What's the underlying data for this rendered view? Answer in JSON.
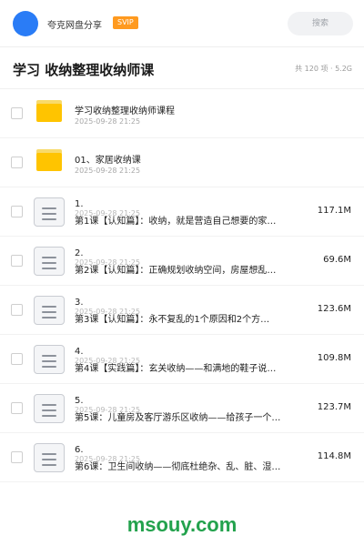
{
  "header": {
    "app_name": "夸克网盘分享",
    "badge": "SVIP",
    "search_placeholder": "搜索"
  },
  "title_row": {
    "title": "学习 收纳整理收纳师课",
    "summary": "共 120 项 · 5.2G"
  },
  "folders": [
    {
      "name": "学习收纳整理收纳师课程",
      "date": "2025-09-28 21:25"
    },
    {
      "name": "01、家居收纳课",
      "date": "2025-09-28 21:25"
    }
  ],
  "files": [
    {
      "num": "1.",
      "date": "2025-09-28 21:25",
      "name": "第1课【认知篇】：收纳，就是营造自己想要的家…",
      "size": "117.1M"
    },
    {
      "num": "2.",
      "date": "2025-09-28 21:25",
      "name": "第2课【认知篇】：正确规划收纳空间，房屋想乱…",
      "size": "69.6M"
    },
    {
      "num": "3.",
      "date": "2025-09-28 21:25",
      "name": "第3课【认知篇】：永不复乱的1个原因和2个方…",
      "size": "123.6M"
    },
    {
      "num": "4.",
      "date": "2025-09-28 21:25",
      "name": "第4课【实践篇】：玄关收纳——和满地的鞋子说…",
      "size": "109.8M"
    },
    {
      "num": "5.",
      "date": "2025-09-28 21:25",
      "name": "第5课：儿童房及客厅游乐区收纳——给孩子一个…",
      "size": "123.7M"
    },
    {
      "num": "6.",
      "date": "2025-09-28 21:25",
      "name": "第6课：卫生间收纳——彻底杜绝杂、乱、脏、湿…",
      "size": "114.8M"
    }
  ],
  "watermark": "msouy.com",
  "colors": {
    "avatar": "#2a7cf6",
    "badge": "#ff9a1f",
    "folder": "#ffc400",
    "watermark": "#23a24d"
  }
}
